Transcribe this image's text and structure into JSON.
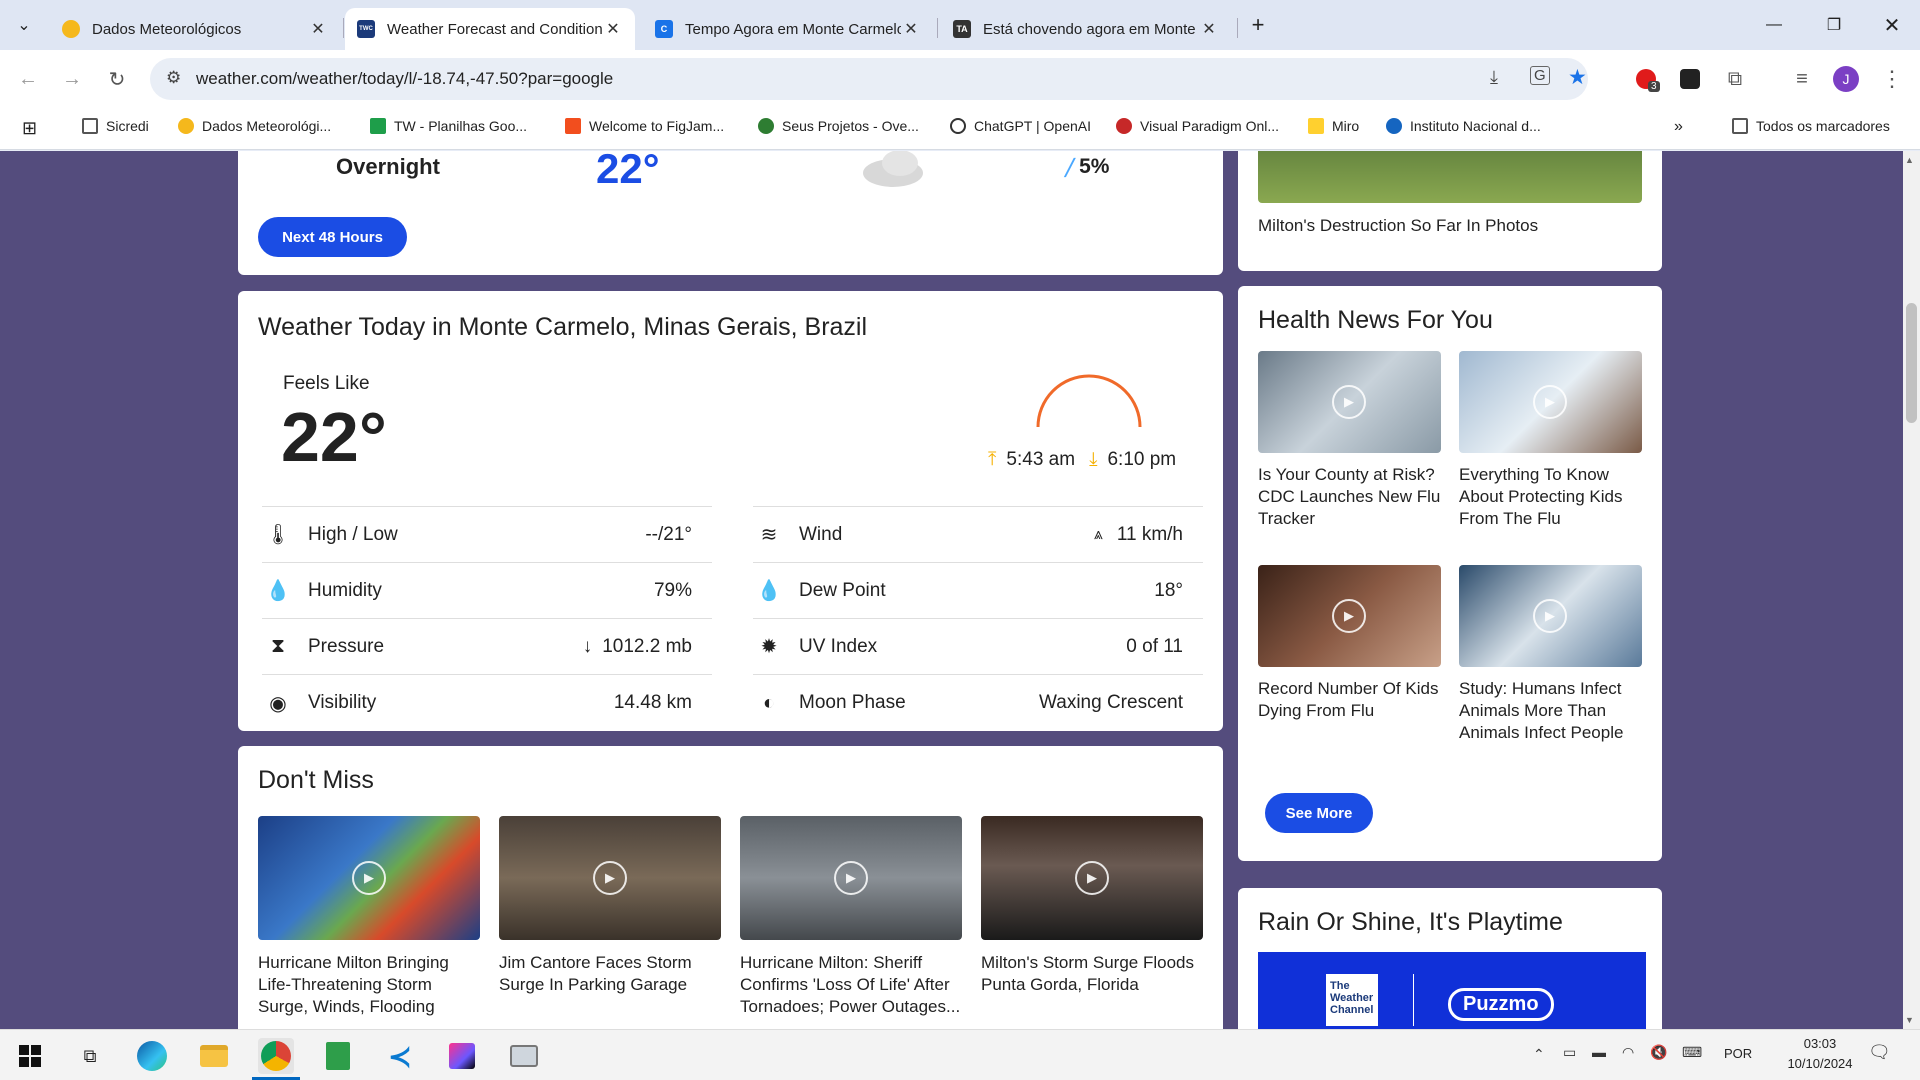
{
  "tabs": [
    {
      "title": "Dados Meteorológicos"
    },
    {
      "title": "Weather Forecast and Conditions"
    },
    {
      "title": "Tempo Agora em Monte Carmelo"
    },
    {
      "title": "Está chovendo agora em Monte Carmelo"
    }
  ],
  "toolbar": {
    "url": "weather.com/weather/today/l/-18.74,-47.50?par=google",
    "extension_badge": "3",
    "profile_initial": "J"
  },
  "bookmarks": [
    {
      "label": "Sicredi"
    },
    {
      "label": "Dados Meteorológi..."
    },
    {
      "label": "TW - Planilhas Goo..."
    },
    {
      "label": "Welcome to FigJam..."
    },
    {
      "label": "Seus Projetos - Ove..."
    },
    {
      "label": "ChatGPT | OpenAI"
    },
    {
      "label": "Visual Paradigm Onl..."
    },
    {
      "label": "Miro"
    },
    {
      "label": "Instituto Nacional d..."
    }
  ],
  "bookmarks_all": "Todos os marcadores",
  "hourly": {
    "period": "Overnight",
    "temp": "22°",
    "precip": "5%",
    "button": "Next 48 Hours"
  },
  "today": {
    "title": "Weather Today in Monte Carmelo, Minas Gerais, Brazil",
    "feels_like_label": "Feels Like",
    "feels_like": "22°",
    "sunrise": "5:43 am",
    "sunset": "6:10 pm",
    "left_rows": [
      {
        "label": "High / Low",
        "value": "--/21°"
      },
      {
        "label": "Humidity",
        "value": "79%"
      },
      {
        "label": "Pressure",
        "value": "1012.2 mb"
      },
      {
        "label": "Visibility",
        "value": "14.48 km"
      }
    ],
    "right_rows": [
      {
        "label": "Wind",
        "value": "11 km/h"
      },
      {
        "label": "Dew Point",
        "value": "18°"
      },
      {
        "label": "UV Index",
        "value": "0 of 11"
      },
      {
        "label": "Moon Phase",
        "value": "Waxing Crescent"
      }
    ]
  },
  "dont_miss": {
    "title": "Don't Miss",
    "items": [
      {
        "caption": "Hurricane Milton Bringing Life-Threatening Storm Surge, Winds, Flooding"
      },
      {
        "caption": "Jim Cantore Faces Storm Surge In Parking Garage"
      },
      {
        "caption": "Hurricane Milton: Sheriff Confirms 'Loss Of Life' After Tornadoes; Power Outages..."
      },
      {
        "caption": "Milton's Storm Surge Floods Punta Gorda, Florida"
      }
    ]
  },
  "sidebar_top": {
    "caption": "Milton's Destruction So Far In Photos"
  },
  "health": {
    "title": "Health News For You",
    "items": [
      {
        "caption": "Is Your County at Risk? CDC Launches New Flu Tracker"
      },
      {
        "caption": "Everything To Know About Protecting Kids From The Flu"
      },
      {
        "caption": "Record Number Of Kids Dying From Flu"
      },
      {
        "caption": "Study: Humans Infect Animals More Than Animals Infect People"
      }
    ],
    "button": "See More"
  },
  "playtime": {
    "title": "Rain Or Shine, It's Playtime",
    "logo1": "The Weather Channel",
    "logo2": "Puzzmo"
  },
  "taskbar": {
    "lang": "POR",
    "time": "03:03",
    "date": "10/10/2024"
  }
}
